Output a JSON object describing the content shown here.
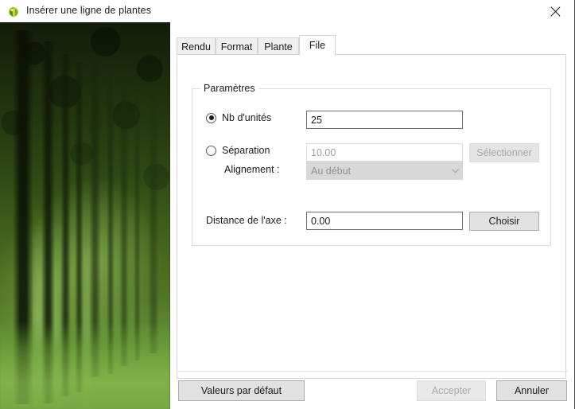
{
  "window": {
    "title": "Insérer une ligne de plantes",
    "icon": "plant-icon",
    "close_label": "✕"
  },
  "preview": {
    "alt": "forest-photo",
    "description": "Photographie d'une forêt de hauts arbres"
  },
  "tabs": [
    {
      "label": "Rendu",
      "active": false
    },
    {
      "label": "Format",
      "active": false
    },
    {
      "label": "Plante",
      "active": false
    },
    {
      "label": "File",
      "active": true
    }
  ],
  "group": {
    "title": "Paramètres",
    "mode_selected": "nb_unites",
    "rows": {
      "nb_unites": {
        "radio_label": "Nb d'unités",
        "selected": true,
        "value": "25",
        "enabled": true
      },
      "separation": {
        "radio_label": "Séparation",
        "selected": false,
        "value": "10.00",
        "enabled": false,
        "button_label": "Sélectionner",
        "button_enabled": false
      },
      "alignement": {
        "label": "Alignement :",
        "value": "Au début",
        "enabled": false,
        "options": [
          "Au début"
        ]
      }
    },
    "distance": {
      "label": "Distance de l'axe :",
      "value": "0.00",
      "enabled": true,
      "button_label": "Choisir",
      "button_enabled": true
    }
  },
  "footer": {
    "defaults_label": "Valeurs par défaut",
    "accept_label": "Accepter",
    "accept_enabled": false,
    "cancel_label": "Annuler",
    "cancel_enabled": true
  },
  "colors": {
    "accent_green": "#7cb342",
    "window_bg": "#ffffff",
    "button_face": "#e1e1e1",
    "disabled_text": "#a8a8a8",
    "border": "#d4d4d4"
  }
}
